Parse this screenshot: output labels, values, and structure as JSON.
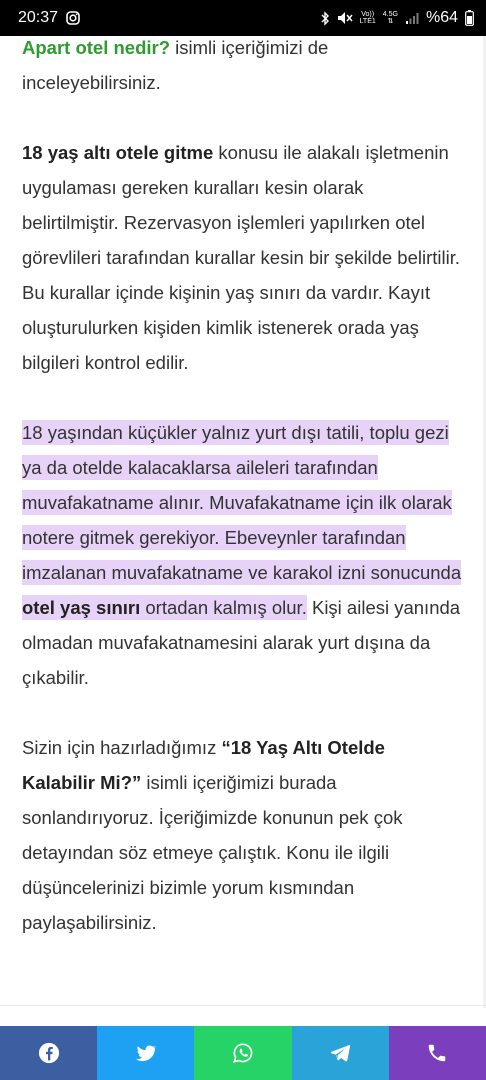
{
  "status_bar": {
    "time": "20:37",
    "network_top": "Vo))",
    "network_bottom": "LTE1",
    "network_type": "4.5G",
    "battery": "%64",
    "icons": [
      "instagram-icon",
      "bluetooth-icon",
      "mute-icon",
      "signal-icon",
      "battery-icon"
    ]
  },
  "article": {
    "p0": {
      "link": "Apart otel nedir?",
      "text": " isimli içeriğimizi de inceleyebilirsiniz."
    },
    "p1": {
      "bold": "18 yaş altı otele gitme",
      "text": " konusu ile alakalı işletmenin uygulaması gereken kuralları kesin olarak belirtilmiştir. Rezervasyon işlemleri yapılırken otel görevlileri tarafından kurallar kesin bir şekilde belirtilir. Bu kurallar içinde kişinin yaş sınırı da vardır. Kayıt oluşturulurken kişiden kimlik istenerek orada yaş bilgileri kontrol edilir."
    },
    "p2": {
      "hl_text": "18 yaşından küçükler yalnız yurt dışı tatili, toplu gezi ya da otelde kalacaklarsa aileleri tarafından muvafakatname alınır. Muvafakatname için ilk olarak notere gitmek gerekiyor. Ebeveynler tarafından imzalanan muvafakatname ve karakol izni sonucunda ",
      "hl_bold": "otel yaş sınırı",
      "hl_text2": " ortadan kalmış olur.",
      "text": " Kişi ailesi yanında olmadan muvafakatnamesini alarak yurt dışına da çıkabilir."
    },
    "p3": {
      "text_before": "Sizin için hazırladığımız ",
      "bold": "“18 Yaş Altı Otelde Kalabilir Mi?”",
      "text_after": " isimli içeriğimizi burada sonlandırıyoruz. İçeriğimizde konunun pek çok detayından söz etmeye çalıştık. Konu ile ilgili düşüncelerinizi bizimle yorum kısmından paylaşabilirsiniz."
    }
  },
  "share_bar": {
    "buttons": [
      {
        "icon": "facebook-icon",
        "color": "#3b5fa0"
      },
      {
        "icon": "twitter-icon",
        "color": "#1ea1f2"
      },
      {
        "icon": "whatsapp-icon",
        "color": "#25d366"
      },
      {
        "icon": "telegram-icon",
        "color": "#2aa3d9"
      },
      {
        "icon": "phone-icon",
        "color": "#7b3fbd"
      }
    ]
  },
  "colors": {
    "link_green": "#2e9c2e",
    "highlight": "#e6d3f7"
  }
}
